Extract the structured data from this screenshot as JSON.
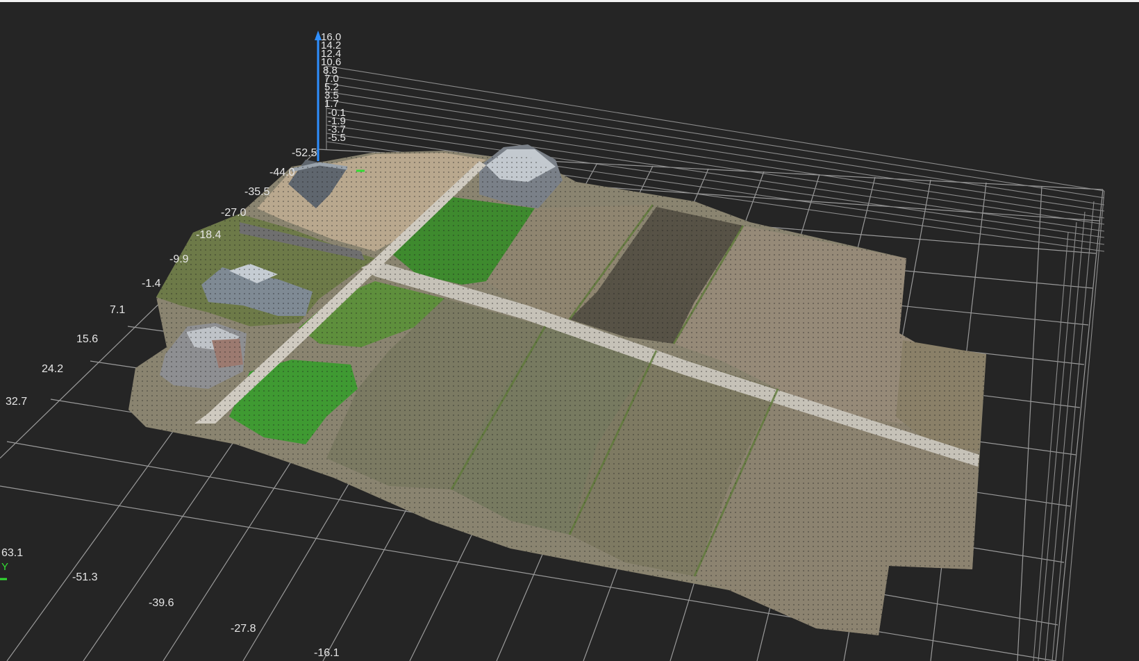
{
  "viewer": {
    "accent": "#2f8fff",
    "grid_color": "#9a9a9a",
    "background": "#252525",
    "y_axis_color": "#33dd33"
  },
  "z_axis": {
    "ticks": [
      "16.0",
      "14.2",
      "12.4",
      "10.6",
      "8.8",
      "7.0",
      "5.2",
      "3.5",
      "1.7",
      "-0.1",
      "-1.9",
      "-3.7",
      "-5.5"
    ]
  },
  "left_axis": {
    "ticks": [
      "-52.5",
      "-44.0",
      "-35.5",
      "-27.0",
      "-18.4",
      "-9.9",
      "-1.4",
      "7.1",
      "15.6",
      "24.2",
      "32.7"
    ]
  },
  "bottom_axis": {
    "ticks": [
      "63.1",
      "-51.3",
      "-39.6",
      "-27.8",
      "-16.1"
    ]
  },
  "axis_y": {
    "letter": "Y"
  }
}
